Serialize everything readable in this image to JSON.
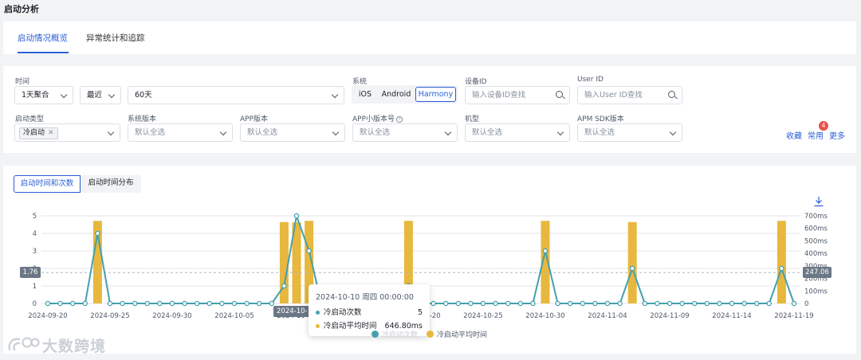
{
  "page": {
    "title": "启动分析"
  },
  "tabs": [
    {
      "label": "启动情况概览",
      "active": true
    },
    {
      "label": "异常统计和追踪",
      "active": false
    }
  ],
  "filters": {
    "time_label": "时间",
    "aggregate": "1天聚合",
    "recent": "最近",
    "range": "60天",
    "system_label": "系统",
    "systems": [
      {
        "label": "iOS",
        "active": false
      },
      {
        "label": "Android",
        "active": false
      },
      {
        "label": "Harmony",
        "active": true
      }
    ],
    "device_id_label": "设备ID",
    "device_id_placeholder": "输入设备ID查找",
    "user_id_label": "User ID",
    "user_id_placeholder": "输入User ID查找",
    "launch_type_label": "启动类型",
    "launch_type_tag": "冷启动",
    "os_version_label": "系统版本",
    "os_version_value": "默认全选",
    "app_version_label": "APP版本",
    "app_version_value": "默认全选",
    "mini_version_label": "APP小版本号",
    "mini_version_value": "默认全选",
    "model_label": "机型",
    "model_value": "默认全选",
    "sdk_label": "APM SDK版本",
    "sdk_value": "默认全选",
    "collect": "收藏",
    "common": "常用",
    "common_badge": "4",
    "more": "更多"
  },
  "chart_tabs": [
    {
      "label": "启动时间和次数",
      "active": true
    },
    {
      "label": "启动时间分布",
      "active": false
    }
  ],
  "chart_data": {
    "type": "bar",
    "x_ticks": [
      "2024-09-20",
      "2024-09-25",
      "2024-09-30",
      "2024-10-05",
      "2024-10-10",
      "2024-10-15",
      "2024-10-20",
      "2024-10-25",
      "2024-10-30",
      "2024-11-04",
      "2024-11-09",
      "2024-11-14",
      "2024-11-19"
    ],
    "x_start": "2024-09-20",
    "x_end": "2024-11-19",
    "y_left_ticks": [
      "0",
      "1",
      "2",
      "3",
      "4",
      "5"
    ],
    "y_left_range": [
      0,
      5
    ],
    "y_right_ticks": [
      "0",
      "100ms",
      "200ms",
      "300ms",
      "400ms",
      "500ms",
      "600ms",
      "700ms"
    ],
    "y_right_range": [
      0,
      700
    ],
    "series": [
      {
        "name": "冷启动次数",
        "kind": "line",
        "axis": "left",
        "color": "#44a0ac",
        "points": [
          [
            "2024-09-20",
            0
          ],
          [
            "2024-09-21",
            0
          ],
          [
            "2024-09-22",
            0
          ],
          [
            "2024-09-23",
            0
          ],
          [
            "2024-09-24",
            4
          ],
          [
            "2024-09-25",
            0
          ],
          [
            "2024-09-26",
            0
          ],
          [
            "2024-09-27",
            0
          ],
          [
            "2024-09-28",
            0
          ],
          [
            "2024-09-29",
            0
          ],
          [
            "2024-09-30",
            0
          ],
          [
            "2024-10-01",
            0
          ],
          [
            "2024-10-02",
            0
          ],
          [
            "2024-10-03",
            0
          ],
          [
            "2024-10-04",
            0
          ],
          [
            "2024-10-05",
            0
          ],
          [
            "2024-10-06",
            0
          ],
          [
            "2024-10-07",
            0
          ],
          [
            "2024-10-08",
            0
          ],
          [
            "2024-10-09",
            1
          ],
          [
            "2024-10-10",
            5
          ],
          [
            "2024-10-11",
            3
          ],
          [
            "2024-10-12",
            0
          ],
          [
            "2024-10-13",
            0
          ],
          [
            "2024-10-14",
            0
          ],
          [
            "2024-10-15",
            0
          ],
          [
            "2024-10-16",
            0
          ],
          [
            "2024-10-17",
            0
          ],
          [
            "2024-10-18",
            0
          ],
          [
            "2024-10-19",
            1
          ],
          [
            "2024-10-20",
            0
          ],
          [
            "2024-10-21",
            0
          ],
          [
            "2024-10-22",
            0
          ],
          [
            "2024-10-23",
            0
          ],
          [
            "2024-10-24",
            0
          ],
          [
            "2024-10-25",
            0
          ],
          [
            "2024-10-26",
            0
          ],
          [
            "2024-10-27",
            0
          ],
          [
            "2024-10-28",
            0
          ],
          [
            "2024-10-29",
            0
          ],
          [
            "2024-10-30",
            3
          ],
          [
            "2024-10-31",
            0
          ],
          [
            "2024-11-01",
            0
          ],
          [
            "2024-11-02",
            0
          ],
          [
            "2024-11-03",
            0
          ],
          [
            "2024-11-04",
            0
          ],
          [
            "2024-11-05",
            0
          ],
          [
            "2024-11-06",
            2
          ],
          [
            "2024-11-07",
            0
          ],
          [
            "2024-11-08",
            0
          ],
          [
            "2024-11-09",
            0
          ],
          [
            "2024-11-10",
            0
          ],
          [
            "2024-11-11",
            0
          ],
          [
            "2024-11-12",
            0
          ],
          [
            "2024-11-13",
            0
          ],
          [
            "2024-11-14",
            0
          ],
          [
            "2024-11-15",
            0
          ],
          [
            "2024-11-16",
            0
          ],
          [
            "2024-11-17",
            0
          ],
          [
            "2024-11-18",
            2
          ],
          [
            "2024-11-19",
            0
          ]
        ]
      },
      {
        "name": "冷启动平均时间",
        "kind": "bar",
        "axis": "right",
        "color": "#e8b83e",
        "points": [
          [
            "2024-09-24",
            660
          ],
          [
            "2024-10-09",
            650
          ],
          [
            "2024-10-10",
            646.8
          ],
          [
            "2024-10-11",
            660
          ],
          [
            "2024-10-19",
            660
          ],
          [
            "2024-10-30",
            660
          ],
          [
            "2024-11-06",
            650
          ],
          [
            "2024-11-18",
            660
          ]
        ]
      }
    ],
    "reference_line": {
      "left_value": "1.76",
      "right_value": "247.06"
    },
    "hover": {
      "x_label": "2024-10-10",
      "title": "2024-10-10 周四 00:00:00",
      "rows": [
        {
          "name": "冷启动次数",
          "value": "5",
          "color": "#44a0ac"
        },
        {
          "name": "冷启动平均时间",
          "value": "646.80ms",
          "color": "#e8b83e"
        }
      ]
    },
    "legend_position": "bottom-center",
    "grid": true
  },
  "watermark": {
    "text": "大数跨境"
  }
}
